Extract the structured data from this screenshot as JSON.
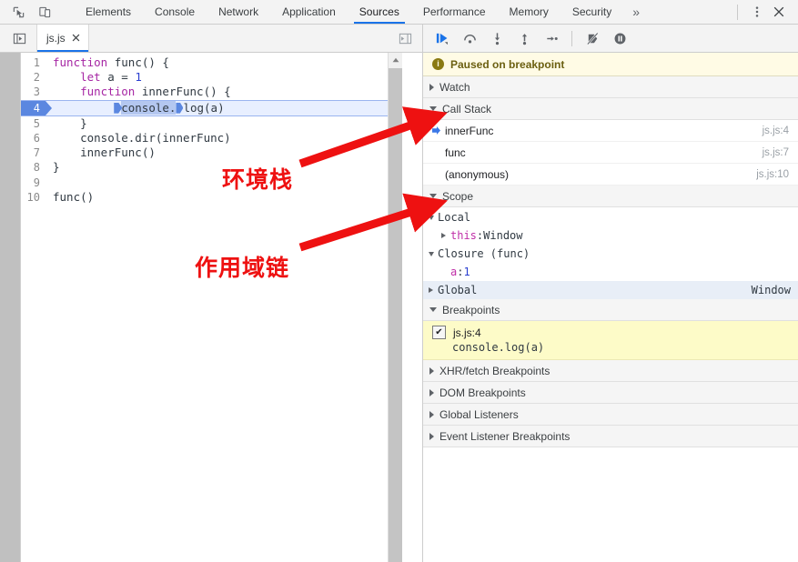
{
  "window": {
    "title": "Chrome DevTools - Sources"
  },
  "topbar": {
    "inspect_icon": "inspect-cursor-icon",
    "device_icon": "device-toolbar-icon",
    "tabs": [
      {
        "label": "Elements",
        "active": false
      },
      {
        "label": "Console",
        "active": false
      },
      {
        "label": "Network",
        "active": false
      },
      {
        "label": "Application",
        "active": false
      },
      {
        "label": "Sources",
        "active": true
      },
      {
        "label": "Performance",
        "active": false
      },
      {
        "label": "Memory",
        "active": false
      },
      {
        "label": "Security",
        "active": false
      }
    ],
    "more_tabs_label": "»",
    "kebab_label": "⋮",
    "close_label": "✕",
    "accent_color": "#1a73e8"
  },
  "filestrip": {
    "navigator_toggle": "show-navigator-icon",
    "file_tab": {
      "name": "js.js",
      "close_label": "✕"
    },
    "right_toggle": "show-quick-open-icon"
  },
  "debugger_toolbar": {
    "buttons": [
      {
        "name": "resume-script-execution",
        "glyph": "resume"
      },
      {
        "name": "step-over-next-function-call",
        "glyph": "step-over"
      },
      {
        "name": "step-into-next-function-call",
        "glyph": "step-into"
      },
      {
        "name": "step-out-of-current-function",
        "glyph": "step-out"
      },
      {
        "name": "step",
        "glyph": "step"
      },
      {
        "name": "deactivate-breakpoints",
        "glyph": "deactivate-breakpoints"
      },
      {
        "name": "pause-on-exceptions",
        "glyph": "pause-on-exceptions"
      }
    ]
  },
  "editor": {
    "lines": [
      {
        "n": "1",
        "tokens": [
          {
            "t": "function",
            "c": "kw"
          },
          {
            "t": " func() {",
            "c": "fn"
          }
        ]
      },
      {
        "n": "2",
        "tokens": [
          {
            "t": "    ",
            "c": "fn"
          },
          {
            "t": "let",
            "c": "kw"
          },
          {
            "t": " a = ",
            "c": "fn"
          },
          {
            "t": "1",
            "c": "num"
          }
        ]
      },
      {
        "n": "3",
        "tokens": [
          {
            "t": "    ",
            "c": "fn"
          },
          {
            "t": "function",
            "c": "kw"
          },
          {
            "t": " innerFunc() {",
            "c": "fn"
          }
        ]
      },
      {
        "n": "4",
        "highlight": true,
        "code": "        console.log(a)"
      },
      {
        "n": "5",
        "tokens": [
          {
            "t": "    }",
            "c": "fn"
          }
        ]
      },
      {
        "n": "6",
        "tokens": [
          {
            "t": "    console.dir(innerFunc)",
            "c": "fn"
          }
        ]
      },
      {
        "n": "7",
        "tokens": [
          {
            "t": "    innerFunc()",
            "c": "fn"
          }
        ]
      },
      {
        "n": "8",
        "tokens": [
          {
            "t": "}",
            "c": "fn"
          }
        ]
      },
      {
        "n": "9",
        "tokens": [
          {
            "t": "",
            "c": "fn"
          }
        ]
      },
      {
        "n": "10",
        "tokens": [
          {
            "t": "func()",
            "c": "fn"
          }
        ]
      }
    ],
    "line4": {
      "indent": "        ",
      "part_selected": "console.",
      "part_rest": "log(a)"
    }
  },
  "right_panel": {
    "paused_banner": {
      "icon": "info-icon",
      "text": "Paused on breakpoint"
    },
    "watch": {
      "label": "Watch",
      "expanded": false
    },
    "call_stack": {
      "label": "Call Stack",
      "expanded": true,
      "frames": [
        {
          "name": "innerFunc",
          "location": "js.js:4",
          "current": true
        },
        {
          "name": "func",
          "location": "js.js:7",
          "current": false
        },
        {
          "name": "(anonymous)",
          "location": "js.js:10",
          "current": false
        }
      ]
    },
    "scope": {
      "label": "Scope",
      "expanded": true,
      "entries": [
        {
          "kind": "group",
          "label": "Local",
          "expanded": true,
          "indent": 1
        },
        {
          "kind": "prop",
          "key": "this",
          "sep": ": ",
          "value": "Window",
          "key_style": "magenta",
          "indent": 2,
          "has_tri": true
        },
        {
          "kind": "group",
          "label": "Closure (func)",
          "expanded": true,
          "indent": 1
        },
        {
          "kind": "prop",
          "key": "a",
          "sep": ": ",
          "value": "1",
          "key_style": "magenta",
          "value_style": "num",
          "indent": 3,
          "has_tri": false
        },
        {
          "kind": "group",
          "label": "Global",
          "expanded": false,
          "indent": 1,
          "right": "Window",
          "selected": true
        }
      ]
    },
    "breakpoints": {
      "label": "Breakpoints",
      "expanded": true,
      "items": [
        {
          "checked": true,
          "check_glyph": "✔",
          "location": "js.js:4",
          "code": "console.log(a)"
        }
      ]
    },
    "other_sections": [
      {
        "label": "XHR/fetch Breakpoints",
        "expanded": false
      },
      {
        "label": "DOM Breakpoints",
        "expanded": false
      },
      {
        "label": "Global Listeners",
        "expanded": false
      },
      {
        "label": "Event Listener Breakpoints",
        "expanded": false
      }
    ]
  },
  "annotations": {
    "color": "#ee1111",
    "items": [
      {
        "text": "环境栈",
        "name": "annotation-execution-stack"
      },
      {
        "text": "作用域链",
        "name": "annotation-scope-chain"
      }
    ]
  }
}
